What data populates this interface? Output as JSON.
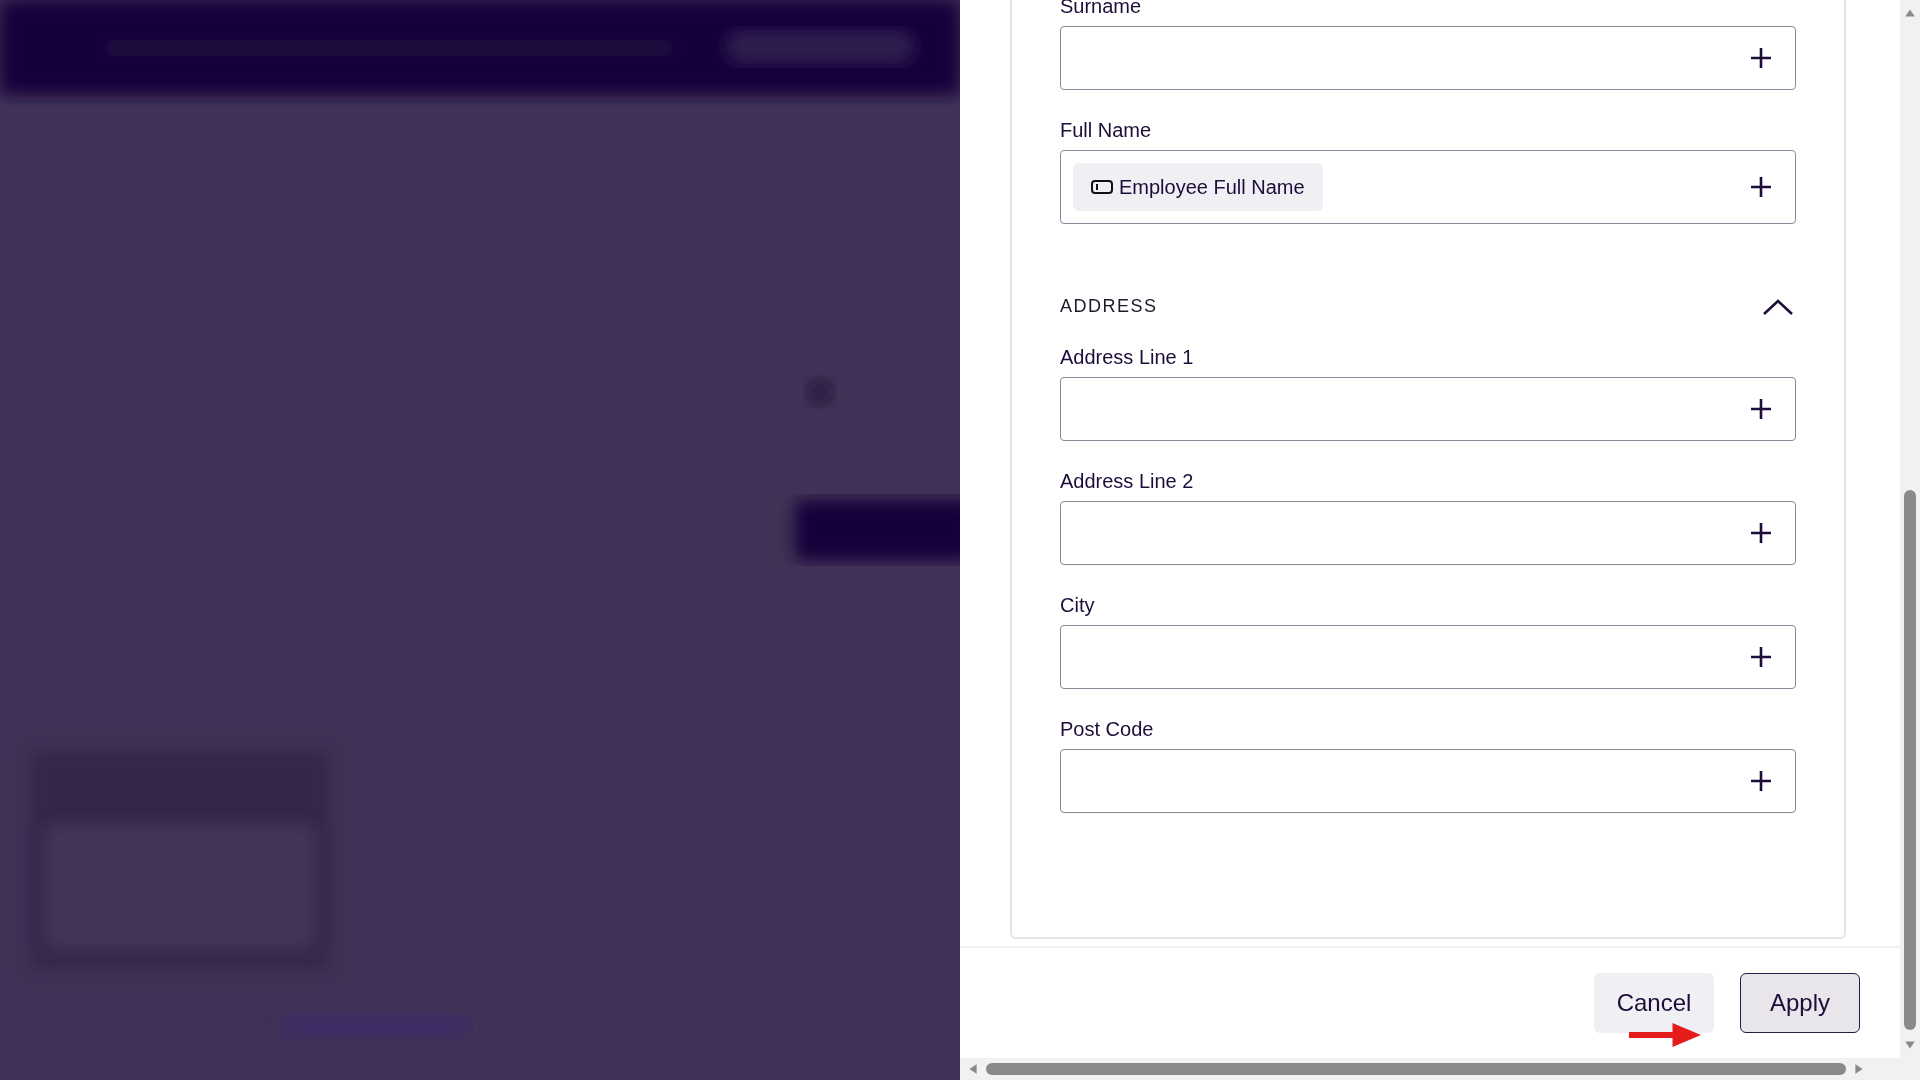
{
  "form": {
    "fields": [
      {
        "kind": "field",
        "label": "Surname"
      },
      {
        "kind": "field",
        "label": "Full Name",
        "chip": "Employee Full Name"
      },
      {
        "kind": "section",
        "label": "ADDRESS",
        "expanded": true
      },
      {
        "kind": "field",
        "label": "Address Line 1"
      },
      {
        "kind": "field",
        "label": "Address Line 2"
      },
      {
        "kind": "field",
        "label": "City"
      },
      {
        "kind": "field",
        "label": "Post Code"
      }
    ]
  },
  "buttons": [
    {
      "label": "Cancel",
      "kind": "secondary"
    },
    {
      "label": "Apply",
      "kind": "primary"
    }
  ]
}
